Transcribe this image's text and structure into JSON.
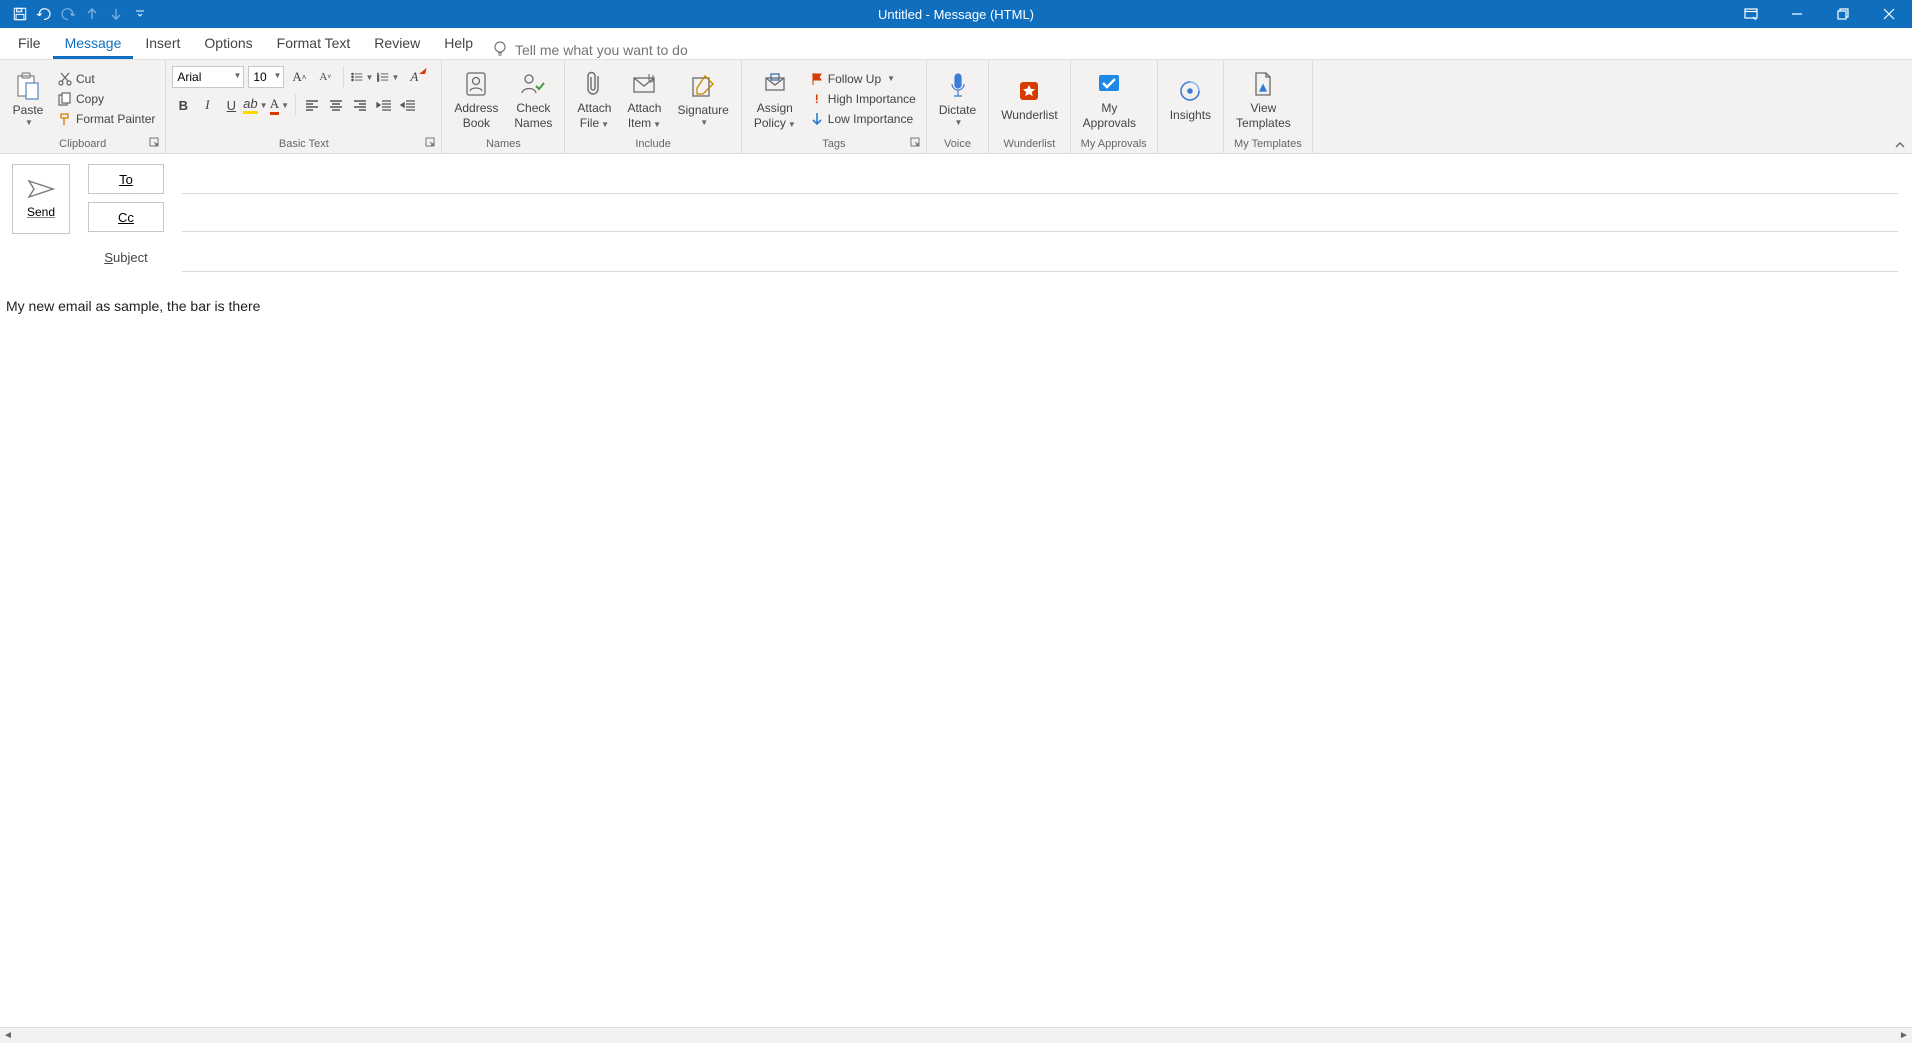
{
  "window": {
    "title": "Untitled  -  Message (HTML)"
  },
  "tabs": {
    "file": "File",
    "message": "Message",
    "insert": "Insert",
    "options": "Options",
    "format_text": "Format Text",
    "review": "Review",
    "help": "Help",
    "tell_me_placeholder": "Tell me what you want to do"
  },
  "ribbon": {
    "clipboard": {
      "paste": "Paste",
      "cut": "Cut",
      "copy": "Copy",
      "format_painter": "Format Painter",
      "label": "Clipboard"
    },
    "basic_text": {
      "font_name": "Arial",
      "font_size": "10",
      "label": "Basic Text"
    },
    "names": {
      "address_book_l1": "Address",
      "address_book_l2": "Book",
      "check_names_l1": "Check",
      "check_names_l2": "Names",
      "label": "Names"
    },
    "include": {
      "attach_file_l1": "Attach",
      "attach_file_l2": "File",
      "attach_item_l1": "Attach",
      "attach_item_l2": "Item",
      "signature": "Signature",
      "label": "Include"
    },
    "tags": {
      "assign_policy_l1": "Assign",
      "assign_policy_l2": "Policy",
      "follow_up": "Follow Up",
      "high": "High Importance",
      "low": "Low Importance",
      "label": "Tags"
    },
    "voice": {
      "dictate": "Dictate",
      "label": "Voice"
    },
    "wunderlist": {
      "button": "Wunderlist",
      "label": "Wunderlist"
    },
    "my_approvals": {
      "button_l1": "My",
      "button_l2": "Approvals",
      "label": "My Approvals"
    },
    "insights": {
      "button": "Insights"
    },
    "my_templates": {
      "button_l1": "View",
      "button_l2": "Templates",
      "label": "My Templates"
    }
  },
  "compose": {
    "send": "Send",
    "to": "To",
    "cc": "Cc",
    "subject": "Subject",
    "body": "My new email as sample, the bar is there"
  }
}
